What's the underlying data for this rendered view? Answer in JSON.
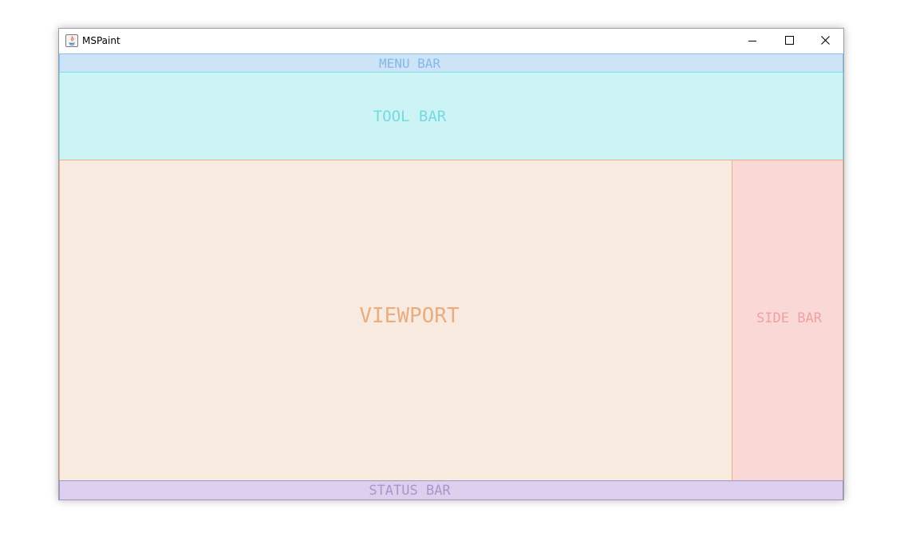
{
  "window": {
    "title": "MSPaint",
    "app_icon": "java-icon",
    "controls": {
      "minimize_icon": "minimize-icon",
      "maximize_icon": "maximize-icon",
      "close_icon": "close-icon"
    }
  },
  "regions": {
    "menu_bar": "MENU BAR",
    "tool_bar": "TOOL BAR",
    "viewport": "VIEWPORT",
    "side_bar": "SIDE BAR",
    "status_bar": "STATUS BAR"
  },
  "colors": {
    "menu_bar_bg": "#cce3f8",
    "tool_bar_bg": "#cdf4f4",
    "viewport_bg": "#f9eadf",
    "side_bar_bg": "#f9d8d6",
    "status_bar_bg": "#dcd0ee"
  }
}
